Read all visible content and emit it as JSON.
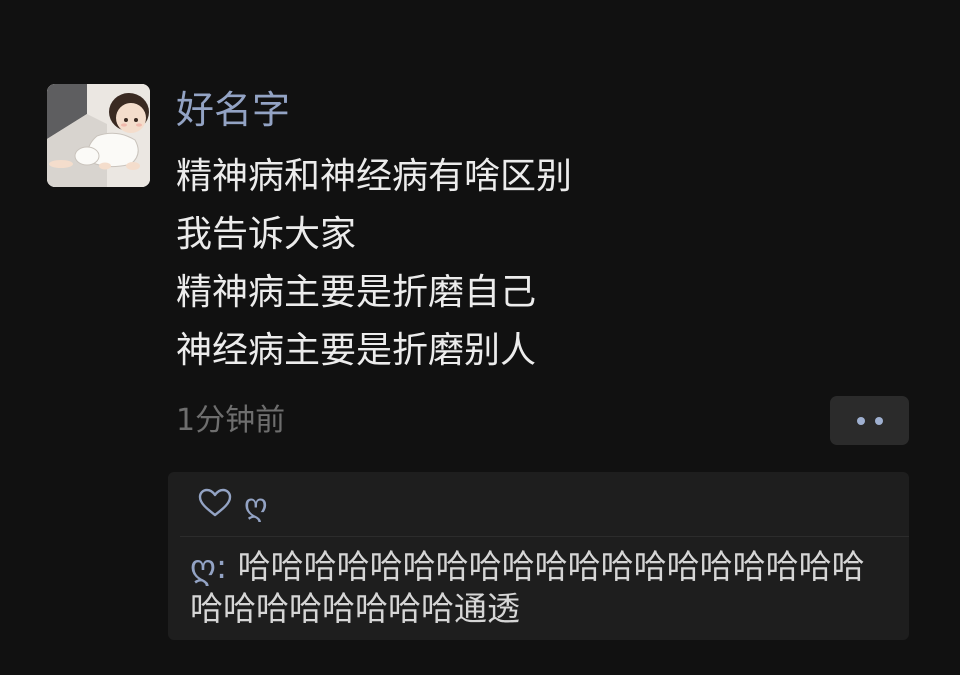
{
  "post": {
    "username": "好名字",
    "content_lines": [
      "精神病和神经病有啥区别",
      "我告诉大家",
      "精神病主要是折磨自己",
      "神经病主要是折磨别人"
    ],
    "timestamp": "1分钟前",
    "avatar_icon": "baby-illustration-avatar"
  },
  "more_button": {
    "icon": "two-dots-icon"
  },
  "interactions": {
    "like_icon": "heart-outline-icon",
    "likers": "ღ",
    "comments": [
      {
        "author": "ღ",
        "separator": ": ",
        "text": "哈哈哈哈哈哈哈哈哈哈哈哈哈哈哈哈哈哈哈哈哈哈哈哈哈哈哈通透"
      }
    ]
  },
  "colors": {
    "background": "#111111",
    "name_blue": "#93a3c4",
    "text": "#ececec",
    "muted": "#6e6e6e",
    "panel": "#1e1e1e",
    "button": "#2b2b2b"
  }
}
